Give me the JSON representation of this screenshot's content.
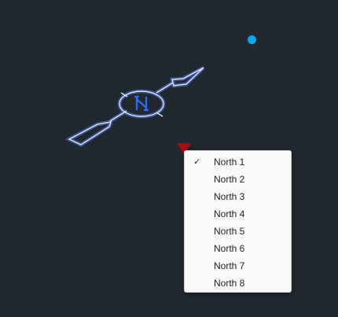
{
  "canvas": {
    "background": "#212830",
    "north_symbol_letter": "N",
    "north_symbol_color": "#2d6dff",
    "grip_color": "#0aa6f2",
    "grip_icon": "blue-grip-circle",
    "dropdown_arrow_color": "#a30f12",
    "dropdown_arrow_icon": "red-triangle-dropdown-arrow"
  },
  "menu": {
    "items": [
      {
        "label": "North 1",
        "checked": true
      },
      {
        "label": "North 2",
        "checked": false
      },
      {
        "label": "North 3",
        "checked": false
      },
      {
        "label": "North 4",
        "checked": false
      },
      {
        "label": "North 5",
        "checked": false
      },
      {
        "label": "North 6",
        "checked": false
      },
      {
        "label": "North 7",
        "checked": false
      },
      {
        "label": "North 8",
        "checked": false
      }
    ],
    "check_mark": "✓"
  }
}
